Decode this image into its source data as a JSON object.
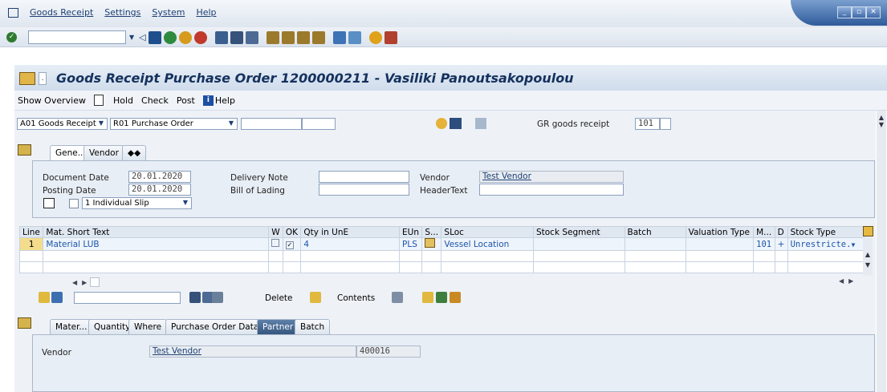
{
  "menu": {
    "items": [
      "Goods Receipt",
      "Settings",
      "System",
      "Help"
    ]
  },
  "title": "Goods Receipt Purchase Order 1200000211 - Vasiliki Panoutsakopoulou",
  "app_toolbar": {
    "show_overview": "Show Overview",
    "hold": "Hold",
    "check": "Check",
    "post": "Post",
    "help": "Help"
  },
  "selectors": {
    "action": "A01 Goods Receipt",
    "ref_doc": "R01 Purchase Order",
    "gr_label": "GR goods receipt",
    "movement_type": "101"
  },
  "header_tabs": [
    "Gene...",
    "Vendor"
  ],
  "header": {
    "doc_date_label": "Document Date",
    "doc_date": "20.01.2020",
    "post_date_label": "Posting Date",
    "post_date": "20.01.2020",
    "delivery_note_label": "Delivery Note",
    "bill_label": "Bill of Lading",
    "vendor_label": "Vendor",
    "vendor": "Test Vendor",
    "header_text_label": "HeaderText",
    "slip": "1 Individual Slip"
  },
  "table": {
    "columns": [
      "Line",
      "Mat. Short Text",
      "W",
      "OK",
      "Qty in UnE",
      "EUn",
      "S...",
      "SLoc",
      "Stock Segment",
      "Batch",
      "Valuation Type",
      "M...",
      "D",
      "Stock Type"
    ],
    "rows": [
      {
        "line": "1",
        "material": "Material LUB",
        "qty": "4",
        "eun": "PLS",
        "sloc": "Vessel Location",
        "mvt": "101",
        "d": "+",
        "stock_type": "Unrestricte."
      }
    ]
  },
  "table_toolbar": {
    "delete": "Delete",
    "contents": "Contents"
  },
  "detail_tabs": [
    "Mater...",
    "Quantity",
    "Where",
    "Purchase Order Data",
    "Partner",
    "Batch"
  ],
  "detail": {
    "vendor_label": "Vendor",
    "vendor_name": "Test Vendor",
    "vendor_no": "400016"
  }
}
